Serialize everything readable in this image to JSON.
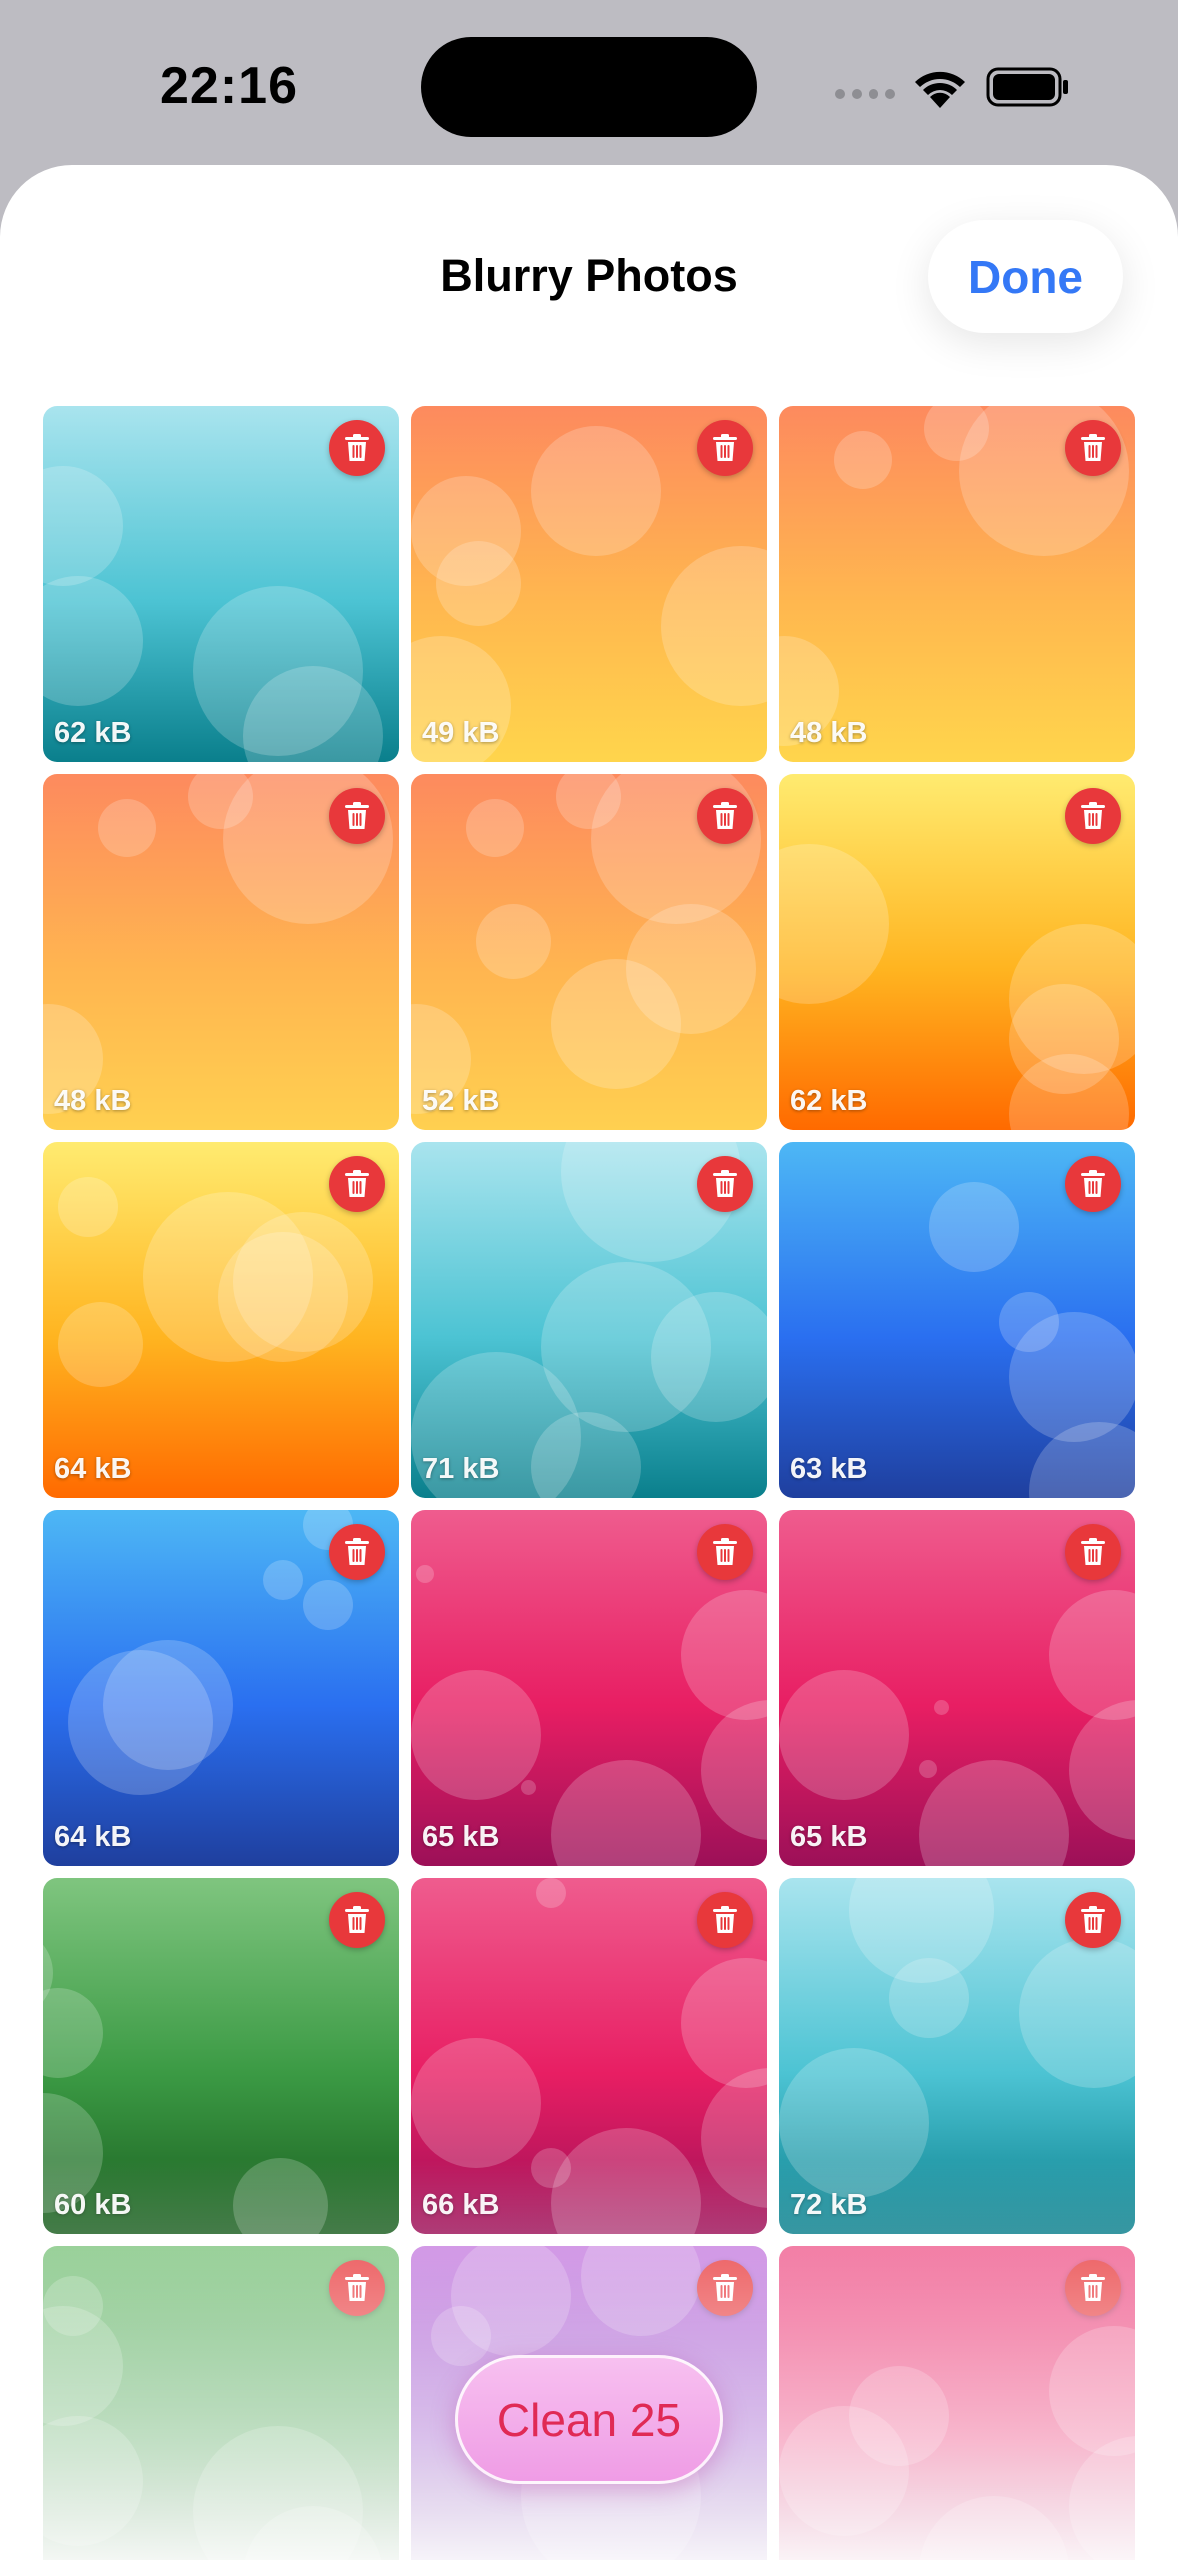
{
  "status_bar": {
    "time": "22:16"
  },
  "header": {
    "title": "Blurry Photos",
    "done_label": "Done"
  },
  "photos": [
    {
      "size": "62 kB",
      "gradient": [
        "#a9e4ee",
        "#4cc3d3",
        "#0a7f8c"
      ]
    },
    {
      "size": "49 kB",
      "gradient": [
        "#fd8a5e",
        "#ffb74f",
        "#ffd54c"
      ]
    },
    {
      "size": "48 kB",
      "gradient": [
        "#fd8a5e",
        "#ffb74f",
        "#ffd54c"
      ]
    },
    {
      "size": "48 kB",
      "gradient": [
        "#fd8a5e",
        "#ffb550",
        "#ffd050"
      ]
    },
    {
      "size": "52 kB",
      "gradient": [
        "#fd8a5e",
        "#ffb550",
        "#ffd050"
      ]
    },
    {
      "size": "62 kB",
      "gradient": [
        "#ffeb70",
        "#ffb420",
        "#ff6a00"
      ]
    },
    {
      "size": "64 kB",
      "gradient": [
        "#ffeb70",
        "#ffb420",
        "#ff6a00"
      ]
    },
    {
      "size": "71 kB",
      "gradient": [
        "#a9e4ee",
        "#4cc3d3",
        "#0a7f8c"
      ]
    },
    {
      "size": "63 kB",
      "gradient": [
        "#4db7f5",
        "#2a6ff0",
        "#1f3f9e"
      ]
    },
    {
      "size": "64 kB",
      "gradient": [
        "#4db7f5",
        "#2a6ff0",
        "#1f3f9e"
      ]
    },
    {
      "size": "65 kB",
      "gradient": [
        "#ef5c8e",
        "#e81e63",
        "#9c1058"
      ]
    },
    {
      "size": "65 kB",
      "gradient": [
        "#ef5c8e",
        "#e81e63",
        "#9c1058"
      ]
    },
    {
      "size": "60 kB",
      "gradient": [
        "#7fc57f",
        "#3b9a44",
        "#1b5e20"
      ]
    },
    {
      "size": "66 kB",
      "gradient": [
        "#ef5c8e",
        "#e81e63",
        "#9c1058"
      ]
    },
    {
      "size": "72 kB",
      "gradient": [
        "#a9e4ee",
        "#4cc3d3",
        "#0a7f8c"
      ]
    },
    {
      "size": "",
      "gradient": [
        "#7fc57f",
        "#3b9a44",
        "#1b5e20"
      ]
    },
    {
      "size": "",
      "gradient": [
        "#c77ee0",
        "#8a3cc2",
        "#4a1580"
      ]
    },
    {
      "size": "",
      "gradient": [
        "#ef5c8e",
        "#e81e63",
        "#9c1058"
      ]
    }
  ],
  "footer": {
    "clean_label": "Clean 25"
  },
  "colors": {
    "accent": "#3478f6",
    "delete": "#e8383b",
    "clean_text": "#e02a55"
  }
}
